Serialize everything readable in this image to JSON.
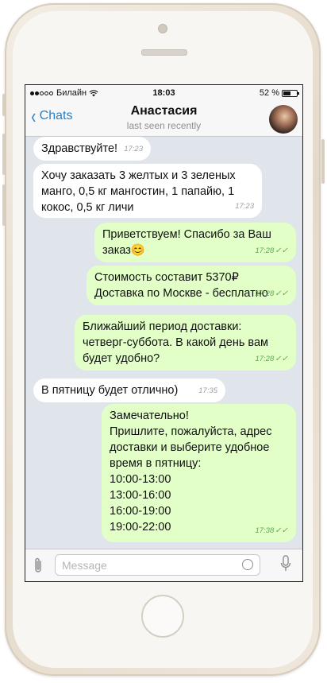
{
  "status_bar": {
    "carrier": "Билайн",
    "time": "18:03",
    "battery": "52 %"
  },
  "navbar": {
    "back_label": "Chats",
    "title": "Анастасия",
    "subtitle": "last seen recently"
  },
  "messages": [
    {
      "direction": "incoming",
      "text": "Здравствуйте!",
      "time": "17:23"
    },
    {
      "direction": "incoming",
      "text": "Хочу заказать 3 желтых и 3 зеленых\nманго, 0,5 кг мангостин, 1 папайю, 1\nкокос, 0,5 кг личи",
      "time": "17:23"
    },
    {
      "direction": "outgoing",
      "text": "Приветствуем! Спасибо за Ваш\nзаказ😊",
      "time": "17:28"
    },
    {
      "direction": "outgoing",
      "text": "Стоимость составит 5370₽\nДоставка по Москве - бесплатно",
      "time": "17:28"
    },
    {
      "direction": "outgoing",
      "text": "Ближайший период доставки:\nчетверг-суббота. В какой день вам\nбудет удобно?",
      "time": "17:28"
    },
    {
      "direction": "incoming",
      "text": "В пятницу будет отлично)",
      "time": "17:35"
    },
    {
      "direction": "outgoing",
      "text": "Замечательно!\nПришлите, пожалуйста, адрес\nдоставки и выберите удобное\nвремя в пятницу:\n10:00-13:00\n13:00-16:00\n16:00-19:00\n19:00-22:00",
      "time": "17:38"
    }
  ],
  "input": {
    "placeholder": "Message",
    "value": ""
  },
  "icons": {
    "attach": "paperclip-icon",
    "sticker": "sticker-icon",
    "voice": "microphone-icon",
    "back": "chevron-left-icon",
    "wifi": "wifi-icon",
    "battery": "battery-icon"
  },
  "colors": {
    "accent": "#2481cc",
    "outgoing_bubble": "#e1ffc7",
    "incoming_bubble": "#ffffff",
    "chat_background": "#dfe5ea",
    "read_ticks": "#62a755"
  }
}
